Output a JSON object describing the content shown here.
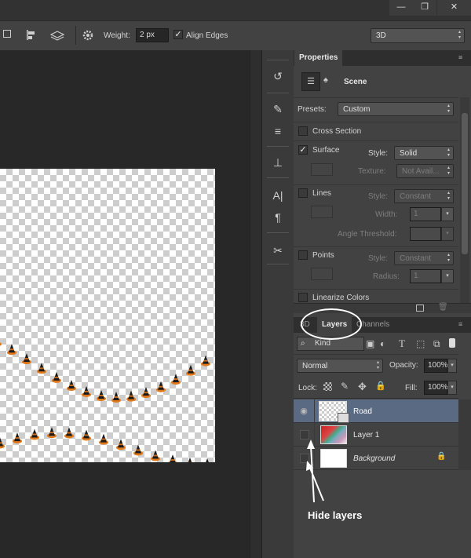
{
  "window": {
    "minimize_glyph": "—",
    "restore_glyph": "❐",
    "close_glyph": "✕"
  },
  "options_bar": {
    "weight_label": "Weight:",
    "weight_value": "2 px",
    "align_edges_label": "Align Edges",
    "align_edges_checked": true,
    "workspace": "3D"
  },
  "properties": {
    "tab_title": "Properties",
    "scene_label": "Scene",
    "presets_label": "Presets:",
    "presets_value": "Custom",
    "cross_section_label": "Cross Section",
    "surface": {
      "label": "Surface",
      "checked": true,
      "style_label": "Style:",
      "style_value": "Solid",
      "texture_label": "Texture:",
      "texture_value": "Not Avail..."
    },
    "lines": {
      "label": "Lines",
      "style_label": "Style:",
      "style_value": "Constant",
      "width_label": "Width:",
      "width_value": "1",
      "angle_label": "Angle Threshold:"
    },
    "points": {
      "label": "Points",
      "style_label": "Style:",
      "style_value": "Constant",
      "radius_label": "Radius:",
      "radius_value": "1"
    },
    "linearize_label": "Linearize Colors"
  },
  "layers_panel": {
    "tabs": [
      "3D",
      "Layers",
      "Channels"
    ],
    "filter_value": "Kind",
    "blend_mode": "Normal",
    "opacity_label": "Opacity:",
    "opacity_value": "100%",
    "lock_label": "Lock:",
    "fill_label": "Fill:",
    "fill_value": "100%",
    "layers": [
      {
        "name": "Road",
        "visible": true,
        "selected": true
      },
      {
        "name": "Layer 1",
        "visible": false,
        "selected": false
      },
      {
        "name": "Background",
        "visible": false,
        "selected": false,
        "locked": true
      }
    ]
  },
  "annotation": {
    "text": "Hide layers"
  },
  "icons": {
    "tool_strip": [
      "history-icon",
      "brush-presets-icon",
      "adjust-icon",
      "clone-source-icon",
      "character-icon",
      "paragraph-icon",
      "tools-icon"
    ]
  },
  "colors": {
    "panel_bg": "#424242",
    "canvas_bg": "#282828",
    "selected_layer": "#5a6a82",
    "cone_orange": "#e07a1c",
    "cone_black": "#1a1a1a"
  }
}
